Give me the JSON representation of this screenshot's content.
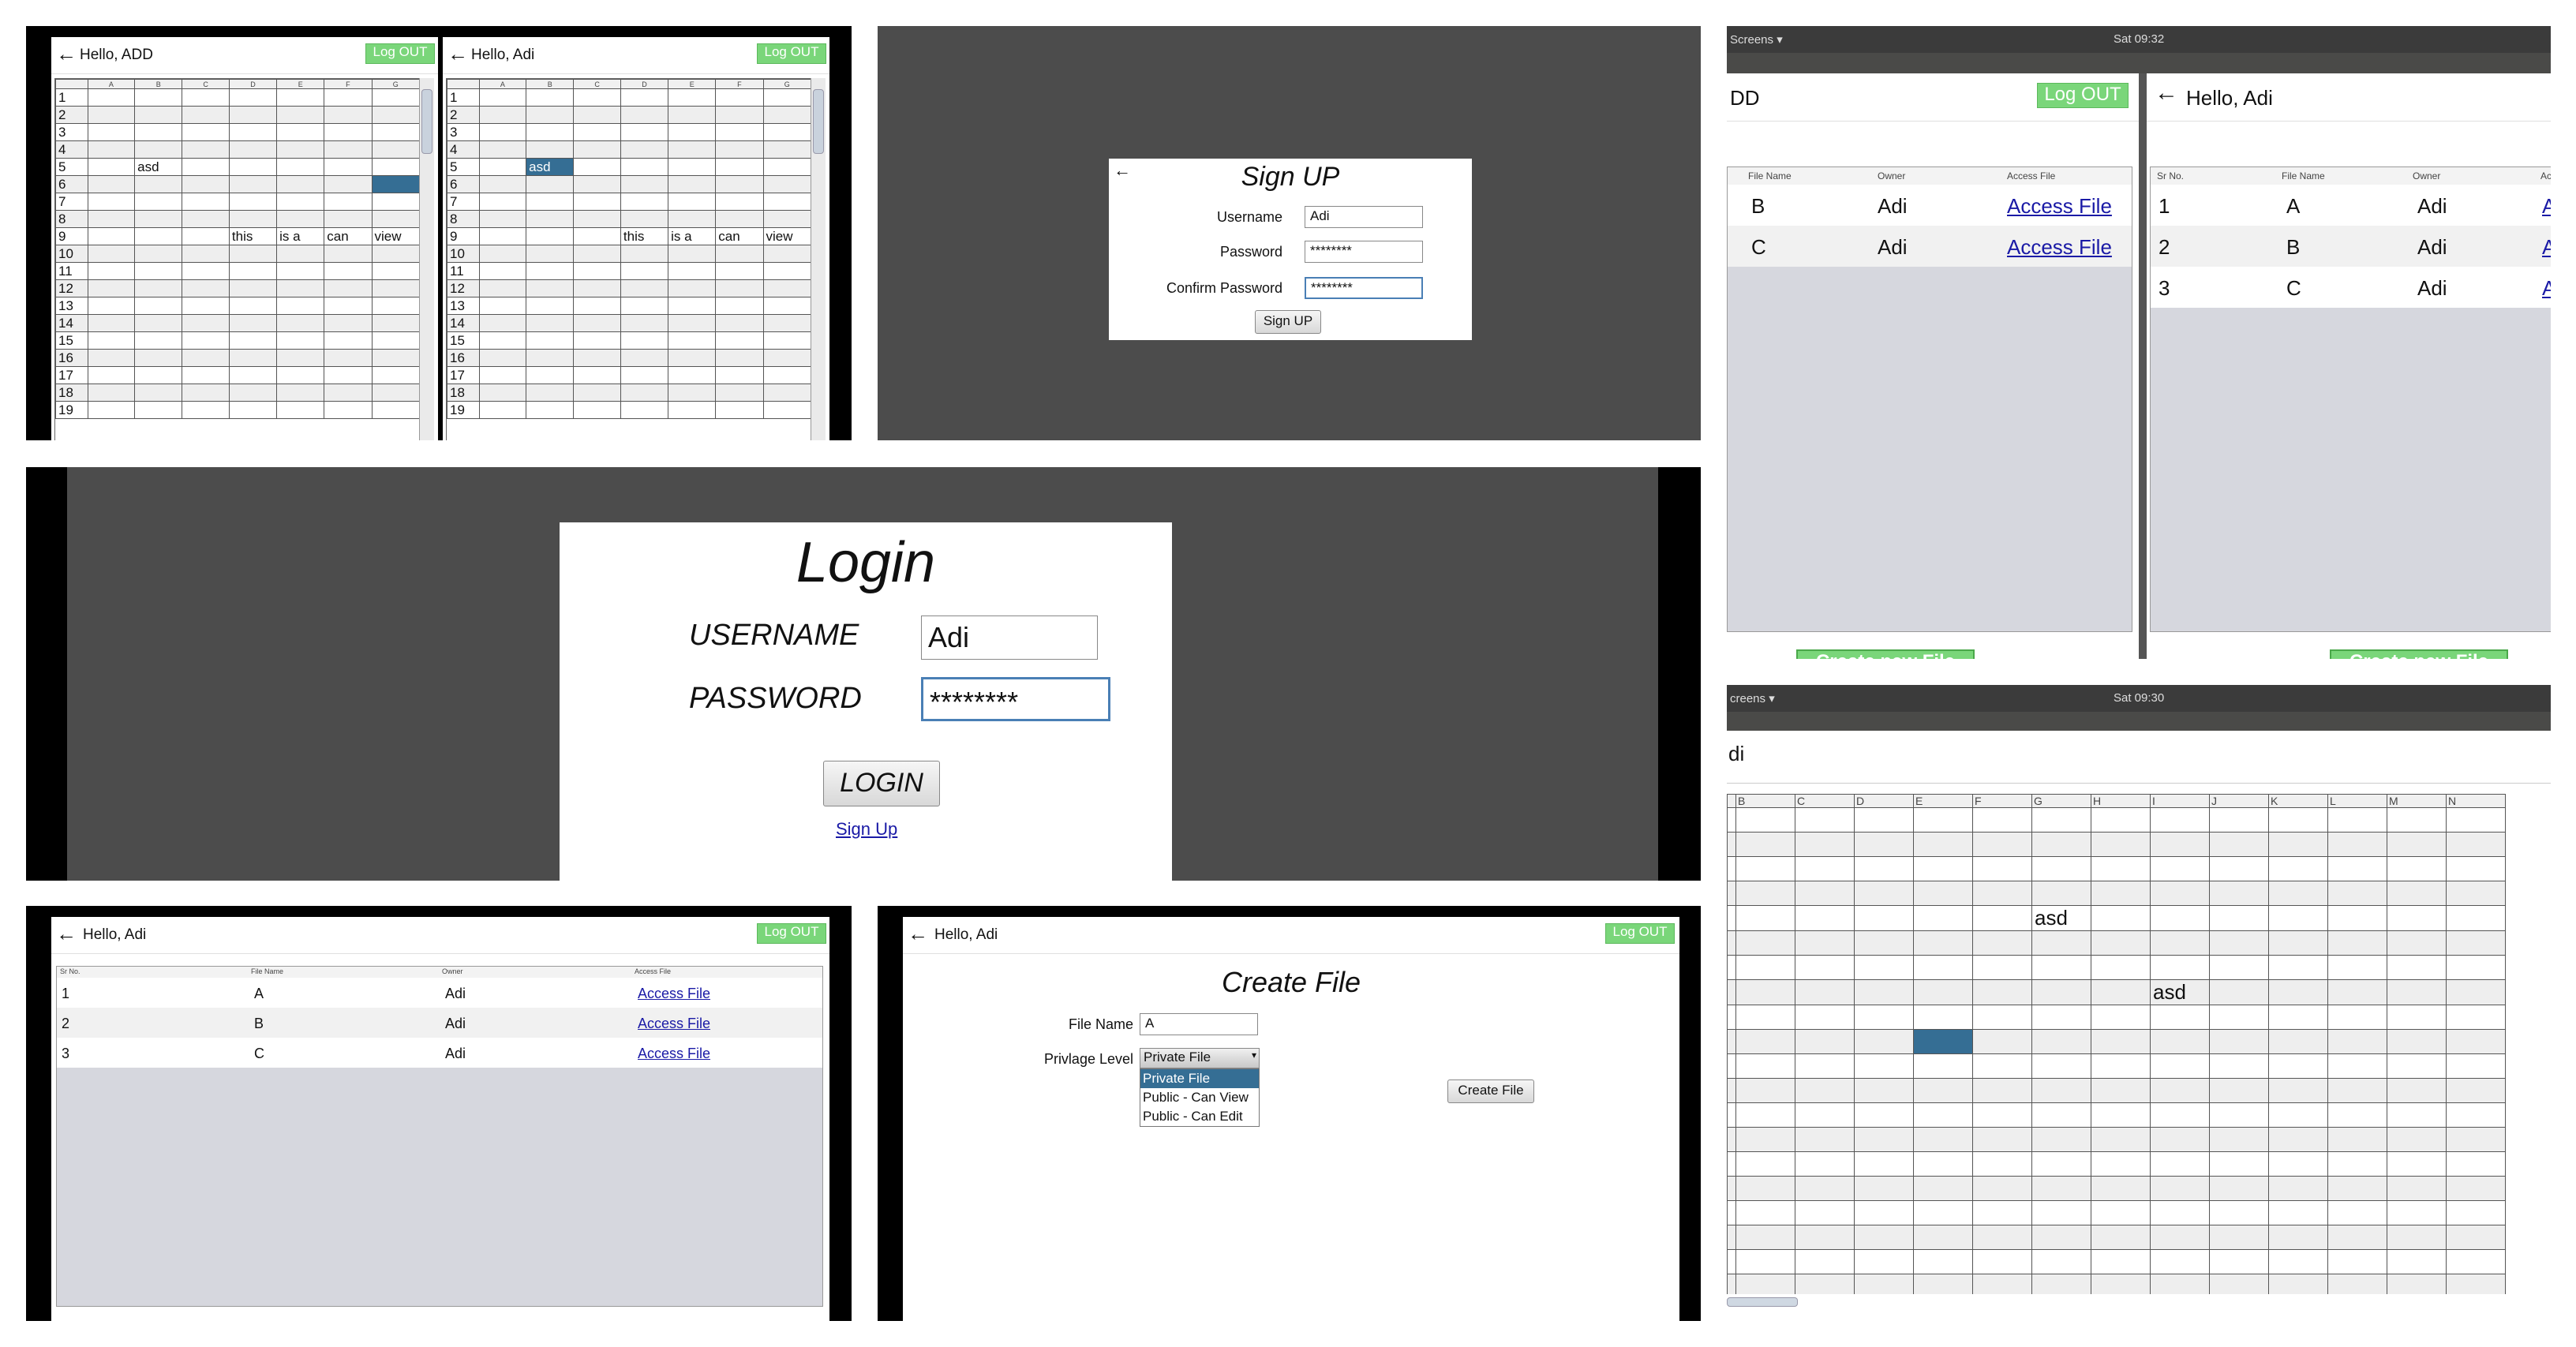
{
  "p1": {
    "left": {
      "back": "←",
      "hello": "Hello, ADD",
      "logout": "Log OUT"
    },
    "right": {
      "back": "←",
      "hello": "Hello, Adi",
      "logout": "Log OUT"
    },
    "cols": [
      "",
      "A",
      "B",
      "C",
      "D",
      "E",
      "F",
      "G"
    ],
    "rows": [
      "1",
      "2",
      "3",
      "4",
      "5",
      "6",
      "7",
      "8",
      "9",
      "10",
      "11",
      "12",
      "13",
      "14",
      "15",
      "16",
      "17",
      "18",
      "19"
    ],
    "left_cells": {
      "r5_B": "asd",
      "r9_D": "this",
      "r9_E": "is a",
      "r9_F": "can",
      "r9_G": "view"
    },
    "right_cells": {
      "r5_B": "asd",
      "r9_D": "this",
      "r9_E": "is a",
      "r9_F": "can",
      "r9_G": "view"
    }
  },
  "p2": {
    "back": "←",
    "title": "Sign UP",
    "username_label": "Username",
    "username_value": "Adi",
    "password_label": "Password",
    "password_value": "********",
    "confirm_label": "Confirm Password",
    "confirm_value": "********",
    "button": "Sign UP"
  },
  "p3": {
    "topbar_left": "Screens ▾",
    "topbar_time": "Sat 09:32",
    "left": {
      "hello": "DD",
      "logout": "Log OUT",
      "headers": [
        "File Name",
        "Owner",
        "Access File"
      ],
      "rows": [
        {
          "name": "B",
          "owner": "Adi",
          "access": "Access File"
        },
        {
          "name": "C",
          "owner": "Adi",
          "access": "Access File"
        }
      ],
      "create": "Create new File"
    },
    "right": {
      "back": "←",
      "hello": "Hello, Adi",
      "headers": [
        "Sr No.",
        "File Name",
        "Owner",
        "Ac"
      ],
      "rows": [
        {
          "sr": "1",
          "name": "A",
          "owner": "Adi",
          "access": "A"
        },
        {
          "sr": "2",
          "name": "B",
          "owner": "Adi",
          "access": "A"
        },
        {
          "sr": "3",
          "name": "C",
          "owner": "Adi",
          "access": "A"
        }
      ],
      "create": "Create new File"
    }
  },
  "p4": {
    "title": "Login",
    "username_label": "USERNAME",
    "username_value": "Adi",
    "password_label": "PASSWORD",
    "password_value": "********",
    "button": "LOGIN",
    "signup_link": "Sign Up"
  },
  "p5": {
    "topbar_left": "creens ▾",
    "topbar_time": "Sat 09:30",
    "hello": "di",
    "cols": [
      "B",
      "C",
      "D",
      "E",
      "F",
      "G",
      "H",
      "I",
      "J",
      "K",
      "L",
      "M",
      "N"
    ],
    "cell_g": "asd",
    "cell_i": "asd"
  },
  "p6": {
    "back": "←",
    "hello": "Hello, Adi",
    "logout": "Log OUT",
    "headers": [
      "Sr No.",
      "File Name",
      "Owner",
      "Access File"
    ],
    "rows": [
      {
        "sr": "1",
        "name": "A",
        "owner": "Adi",
        "access": "Access File"
      },
      {
        "sr": "2",
        "name": "B",
        "owner": "Adi",
        "access": "Access File"
      },
      {
        "sr": "3",
        "name": "C",
        "owner": "Adi",
        "access": "Access File"
      }
    ]
  },
  "p7": {
    "back": "←",
    "hello": "Hello, Adi",
    "logout": "Log OUT",
    "title": "Create File",
    "filename_label": "File Name",
    "filename_value": "A",
    "privilege_label": "Privlage Level",
    "privilege_selected": "Private File",
    "privilege_options": [
      "Private File",
      "Public - Can View",
      "Public - Can Edit"
    ],
    "button": "Create File"
  },
  "colors": {
    "logout_green": "#7ad67a",
    "selection_blue": "#356e94",
    "background_grey": "#4c4c4c",
    "link_blue": "#1a1aa6"
  }
}
